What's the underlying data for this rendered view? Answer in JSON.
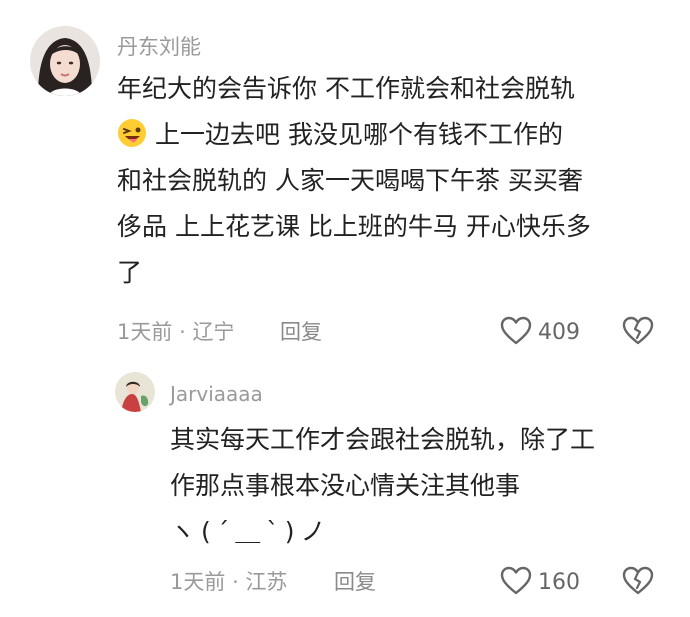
{
  "comment": {
    "username": "丹东刘能",
    "lines": [
      "年纪大的会告诉你 不工作就会和社会脱轨",
      "上一边去吧 我没见哪个有钱不工作的",
      "和社会脱轨的 人家一天喝喝下午茶 买买奢",
      "侈品 上上花艺课 比上班的牛马 开心快乐多",
      "了"
    ],
    "emoji": "wink-tongue-emoji",
    "time": "1天前",
    "separator": "·",
    "location": "辽宁",
    "reply_label": "回复",
    "likes": "409"
  },
  "reply": {
    "username": "Jarviaaaa",
    "lines": [
      "其实每天工作才会跟社会脱轨，除了工",
      "作那点事根本没心情关注其他事"
    ],
    "emoticon": "ヽ(ˊ＿ˋ)ノ",
    "time": "1天前",
    "separator": "·",
    "location": "江苏",
    "reply_label": "回复",
    "likes": "160"
  },
  "colors": {
    "text": "#222222",
    "muted": "#9a9a9a",
    "icon": "#666666"
  },
  "icons": [
    "heart-icon",
    "broken-heart-icon"
  ]
}
